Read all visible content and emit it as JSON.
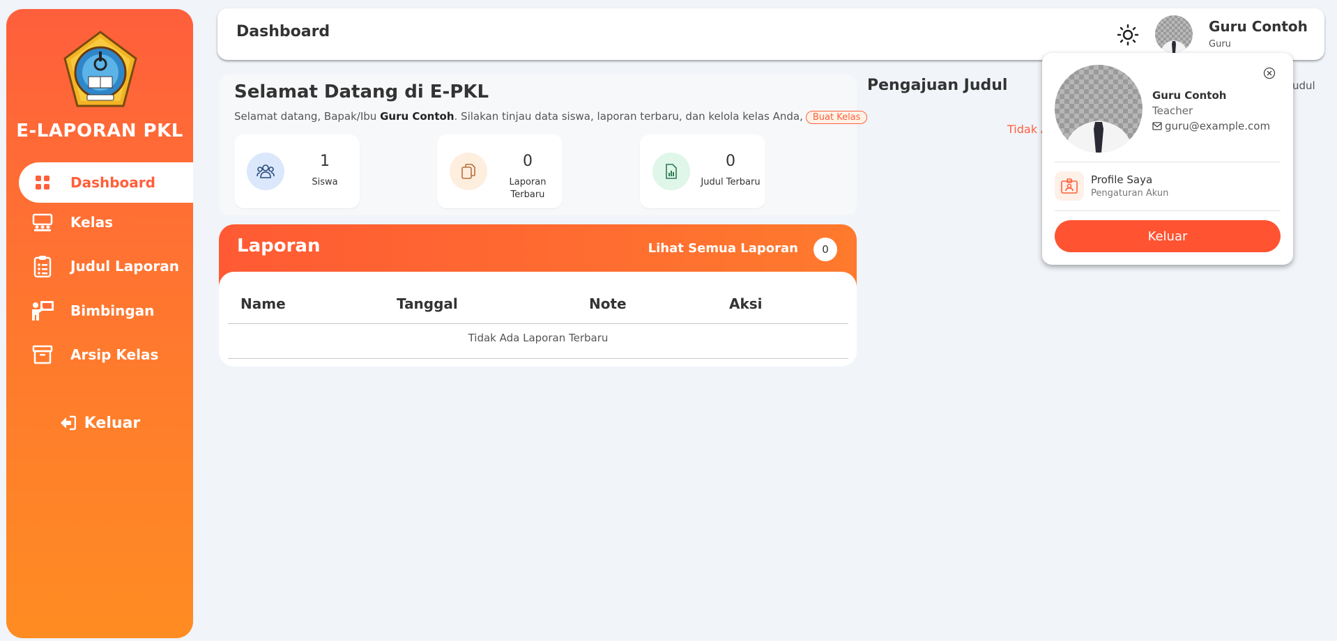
{
  "sidebar": {
    "brand": "E-LAPORAN PKL",
    "items": [
      {
        "label": "Dashboard"
      },
      {
        "label": "Kelas"
      },
      {
        "label": "Judul Laporan"
      },
      {
        "label": "Bimbingan"
      },
      {
        "label": "Arsip Kelas"
      }
    ],
    "logout_label": "Keluar"
  },
  "header": {
    "title": "Dashboard",
    "user_name": "Guru Contoh",
    "user_role": "Guru"
  },
  "welcome": {
    "title": "Selamat Datang di E-PKL",
    "text_before": "Selamat datang, Bapak/Ibu ",
    "text_name": "Guru Contoh",
    "text_after": ". Silakan tinjau data siswa, laporan terbaru, dan kelola kelas Anda,",
    "button": "Buat Kelas",
    "stats": [
      {
        "value": "1",
        "label": "Siswa"
      },
      {
        "value": "0",
        "label": "Laporan Terbaru"
      },
      {
        "value": "0",
        "label": "Judul Terbaru"
      }
    ]
  },
  "laporan": {
    "title": "Laporan",
    "link": "Lihat Semua Laporan",
    "count": "0",
    "columns": [
      "Name",
      "Tanggal",
      "Note",
      "Aksi"
    ],
    "empty": "Tidak Ada Laporan Terbaru"
  },
  "pengajuan": {
    "title": "Pengajuan Judul",
    "empty_visible": "Tidak A",
    "link_visible": "udul"
  },
  "popup": {
    "name": "Guru Contoh",
    "role": "Teacher",
    "email": "guru@example.com",
    "menu_title": "Profile Saya",
    "menu_sub": "Pengaturan Akun",
    "logout": "Keluar"
  },
  "colors": {
    "accent": "#ff5f3c",
    "accent_light": "#ff8c22",
    "stat_blue": "#dbe8fb",
    "stat_orange": "#fdeede",
    "stat_green": "#dff6e8"
  }
}
